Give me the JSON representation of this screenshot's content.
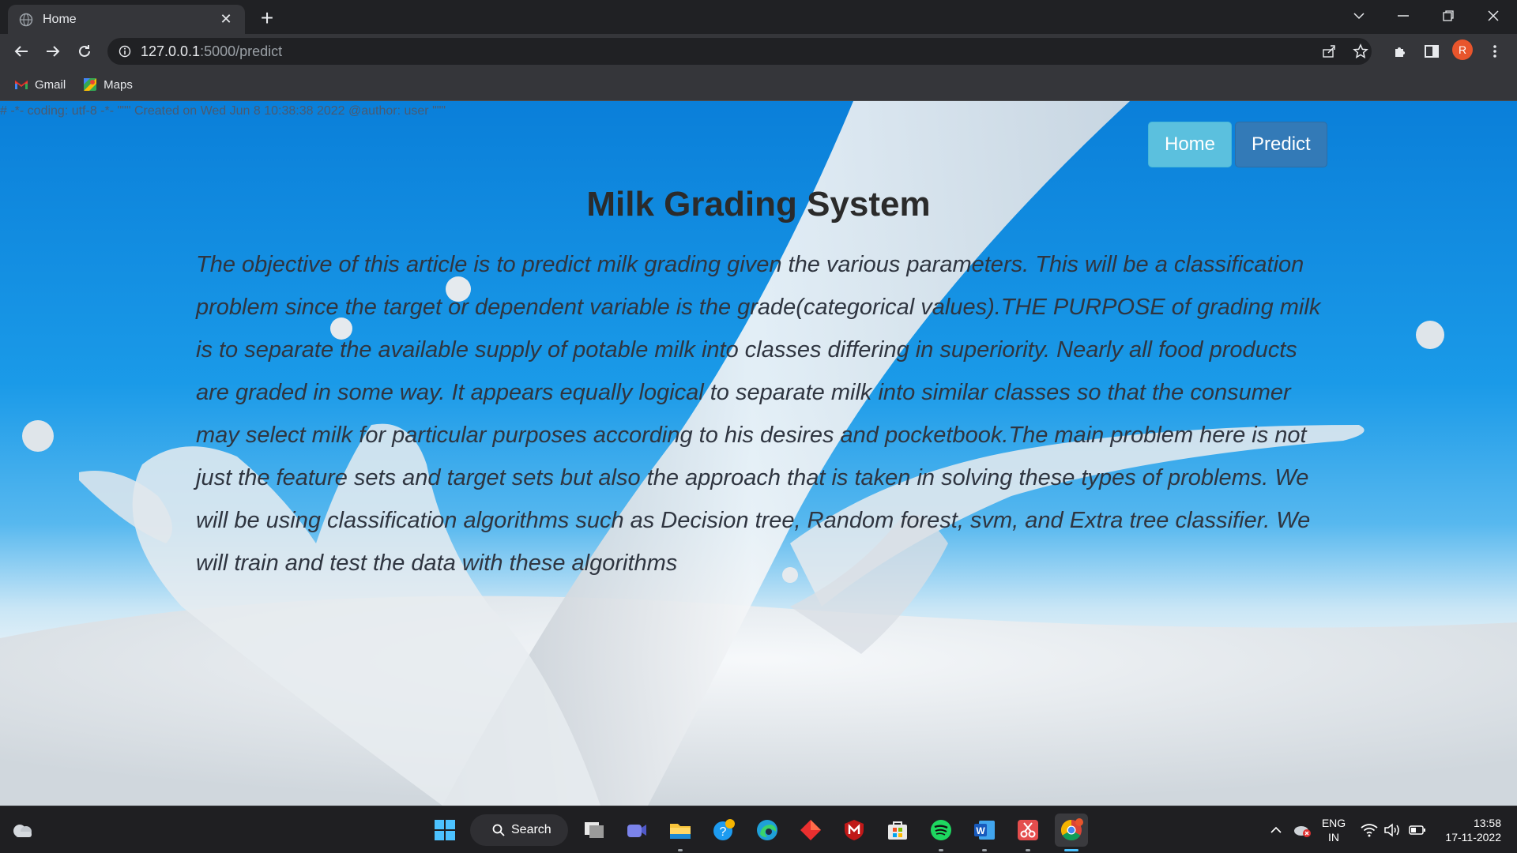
{
  "browser": {
    "tab_title": "Home",
    "url_host": "127.0.0.1",
    "url_path": ":5000/predict",
    "profile_initial": "R",
    "bookmarks": [
      {
        "label": "Gmail",
        "icon": "gmail-icon"
      },
      {
        "label": "Maps",
        "icon": "maps-icon"
      }
    ]
  },
  "page": {
    "code_header": "# -*- coding: utf-8 -*- \"\"\" Created on Wed Jun 8 10:38:38 2022 @author: user \"\"\"",
    "nav": {
      "home_label": "Home",
      "predict_label": "Predict"
    },
    "title": "Milk Grading System",
    "article": "The objective of this article is to predict milk grading given the various parameters. This will be a classification problem since the target or dependent variable is the grade(categorical values).THE PURPOSE of grading milk is to separate the available supply of potable milk into classes differing in superiority. Nearly all food products are graded in some way. It appears equally logical to separate milk into similar classes so that the consumer may select milk for particular purposes according to his desires and pocketbook.The main problem here is not just the feature sets and target sets but also the approach that is taken in solving these types of problems. We will be using classification algorithms such as Decision tree, Random forest, svm, and Extra tree classifier. We will train and test the data with these algorithms",
    "colors": {
      "home_button": "#5bc0de",
      "predict_button": "#337ab7",
      "background_blue": "#0a7fd9"
    }
  },
  "taskbar": {
    "search_label": "Search",
    "language": "ENG",
    "region": "IN",
    "time": "13:58",
    "date": "17-11-2022",
    "apps": [
      "start-icon",
      "task-view-icon",
      "teams-icon",
      "file-explorer-icon",
      "help-icon",
      "edge-icon",
      "app-diamond-icon",
      "mcafee-icon",
      "store-icon",
      "spotify-icon",
      "word-icon",
      "snipping-tool-icon",
      "chrome-icon"
    ]
  }
}
